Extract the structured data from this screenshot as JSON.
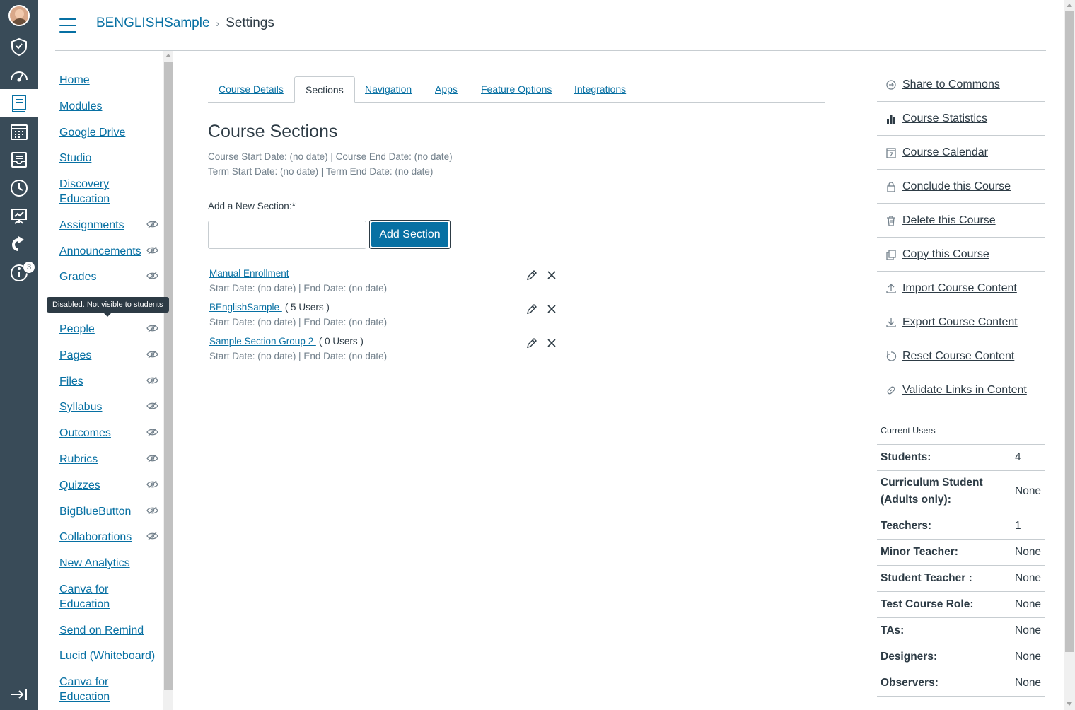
{
  "header": {
    "breadcrumb_course": "BENGLISHSample",
    "breadcrumb_separator": "›",
    "breadcrumb_current": "Settings"
  },
  "global_nav": {
    "badge_count": "3",
    "icons": [
      "avatar",
      "admin-icon",
      "dashboard-icon",
      "courses-icon",
      "calendar-icon",
      "inbox-icon",
      "history-icon",
      "commons-icon",
      "leave-icon",
      "help-icon",
      "collapse-icon"
    ]
  },
  "course_nav": {
    "items": [
      {
        "label": "Home",
        "hidden": false
      },
      {
        "label": "Modules",
        "hidden": false
      },
      {
        "label": "Google Drive",
        "hidden": false
      },
      {
        "label": "Studio",
        "hidden": false
      },
      {
        "label": "Discovery Education",
        "hidden": false
      },
      {
        "label": "Assignments",
        "hidden": true
      },
      {
        "label": "Announcements",
        "hidden": true
      },
      {
        "label": "Grades",
        "hidden": true
      },
      {
        "label": "People",
        "hidden": true
      },
      {
        "label": "Pages",
        "hidden": true
      },
      {
        "label": "Files",
        "hidden": true
      },
      {
        "label": "Syllabus",
        "hidden": true
      },
      {
        "label": "Outcomes",
        "hidden": true
      },
      {
        "label": "Rubrics",
        "hidden": true
      },
      {
        "label": "Quizzes",
        "hidden": true
      },
      {
        "label": "BigBlueButton",
        "hidden": true
      },
      {
        "label": "Collaborations",
        "hidden": true
      },
      {
        "label": "New Analytics",
        "hidden": false
      },
      {
        "label": "Canva for Education",
        "hidden": false
      },
      {
        "label": "Send on Remind",
        "hidden": false
      },
      {
        "label": "Lucid (Whiteboard)",
        "hidden": false
      },
      {
        "label": "Canva for Education",
        "hidden": false
      }
    ],
    "tooltip": "Disabled. Not visible to students"
  },
  "tabs": [
    "Course Details",
    "Sections",
    "Navigation",
    "Apps",
    "Feature Options",
    "Integrations"
  ],
  "active_tab": "Sections",
  "main": {
    "title": "Course Sections",
    "course_dates": "Course Start Date: (no date) | Course End Date: (no date)",
    "term_dates": "Term Start Date: (no date) | Term End Date: (no date)",
    "add_label": "Add a New Section:*",
    "add_input_value": "",
    "add_button": "Add Section",
    "sections": [
      {
        "name": "Manual Enrollment",
        "count": "",
        "dates": "Start Date: (no date) | End Date: (no date)"
      },
      {
        "name": "BEnglishSample ",
        "count": "( 5 Users )",
        "dates": "Start Date: (no date) | End Date: (no date)"
      },
      {
        "name": "Sample Section Group 2 ",
        "count": "( 0 Users )",
        "dates": "Start Date: (no date) | End Date: (no date)"
      }
    ]
  },
  "sidebar": {
    "links": [
      {
        "label": "Share to Commons",
        "icon": "share-icon"
      },
      {
        "label": "Course Statistics",
        "icon": "statistics-icon"
      },
      {
        "label": "Course Calendar",
        "icon": "calendar-icon"
      },
      {
        "label": "Conclude this Course",
        "icon": "lock-icon"
      },
      {
        "label": "Delete this Course",
        "icon": "trash-icon"
      },
      {
        "label": "Copy this Course",
        "icon": "copy-icon"
      },
      {
        "label": "Import Course Content",
        "icon": "upload-icon"
      },
      {
        "label": "Export Course Content",
        "icon": "download-icon"
      },
      {
        "label": "Reset Course Content",
        "icon": "reset-icon"
      },
      {
        "label": "Validate Links in Content",
        "icon": "link-icon"
      }
    ],
    "current_users_title": "Current Users",
    "users": [
      {
        "role": "Students:",
        "count": "4"
      },
      {
        "role": "Curriculum Student (Adults only):",
        "count": "None"
      },
      {
        "role": "Teachers:",
        "count": "1"
      },
      {
        "role": "Minor Teacher:",
        "count": "None"
      },
      {
        "role": "Student Teacher :",
        "count": "None"
      },
      {
        "role": "Test Course Role:",
        "count": "None"
      },
      {
        "role": "TAs:",
        "count": "None"
      },
      {
        "role": "Designers:",
        "count": "None"
      },
      {
        "role": "Observers:",
        "count": "None"
      }
    ]
  },
  "colors": {
    "nav_bg": "#394b58",
    "link": "#0770a3",
    "text": "#2d3b45",
    "muted": "#73818c",
    "border": "#c7cdd1"
  }
}
